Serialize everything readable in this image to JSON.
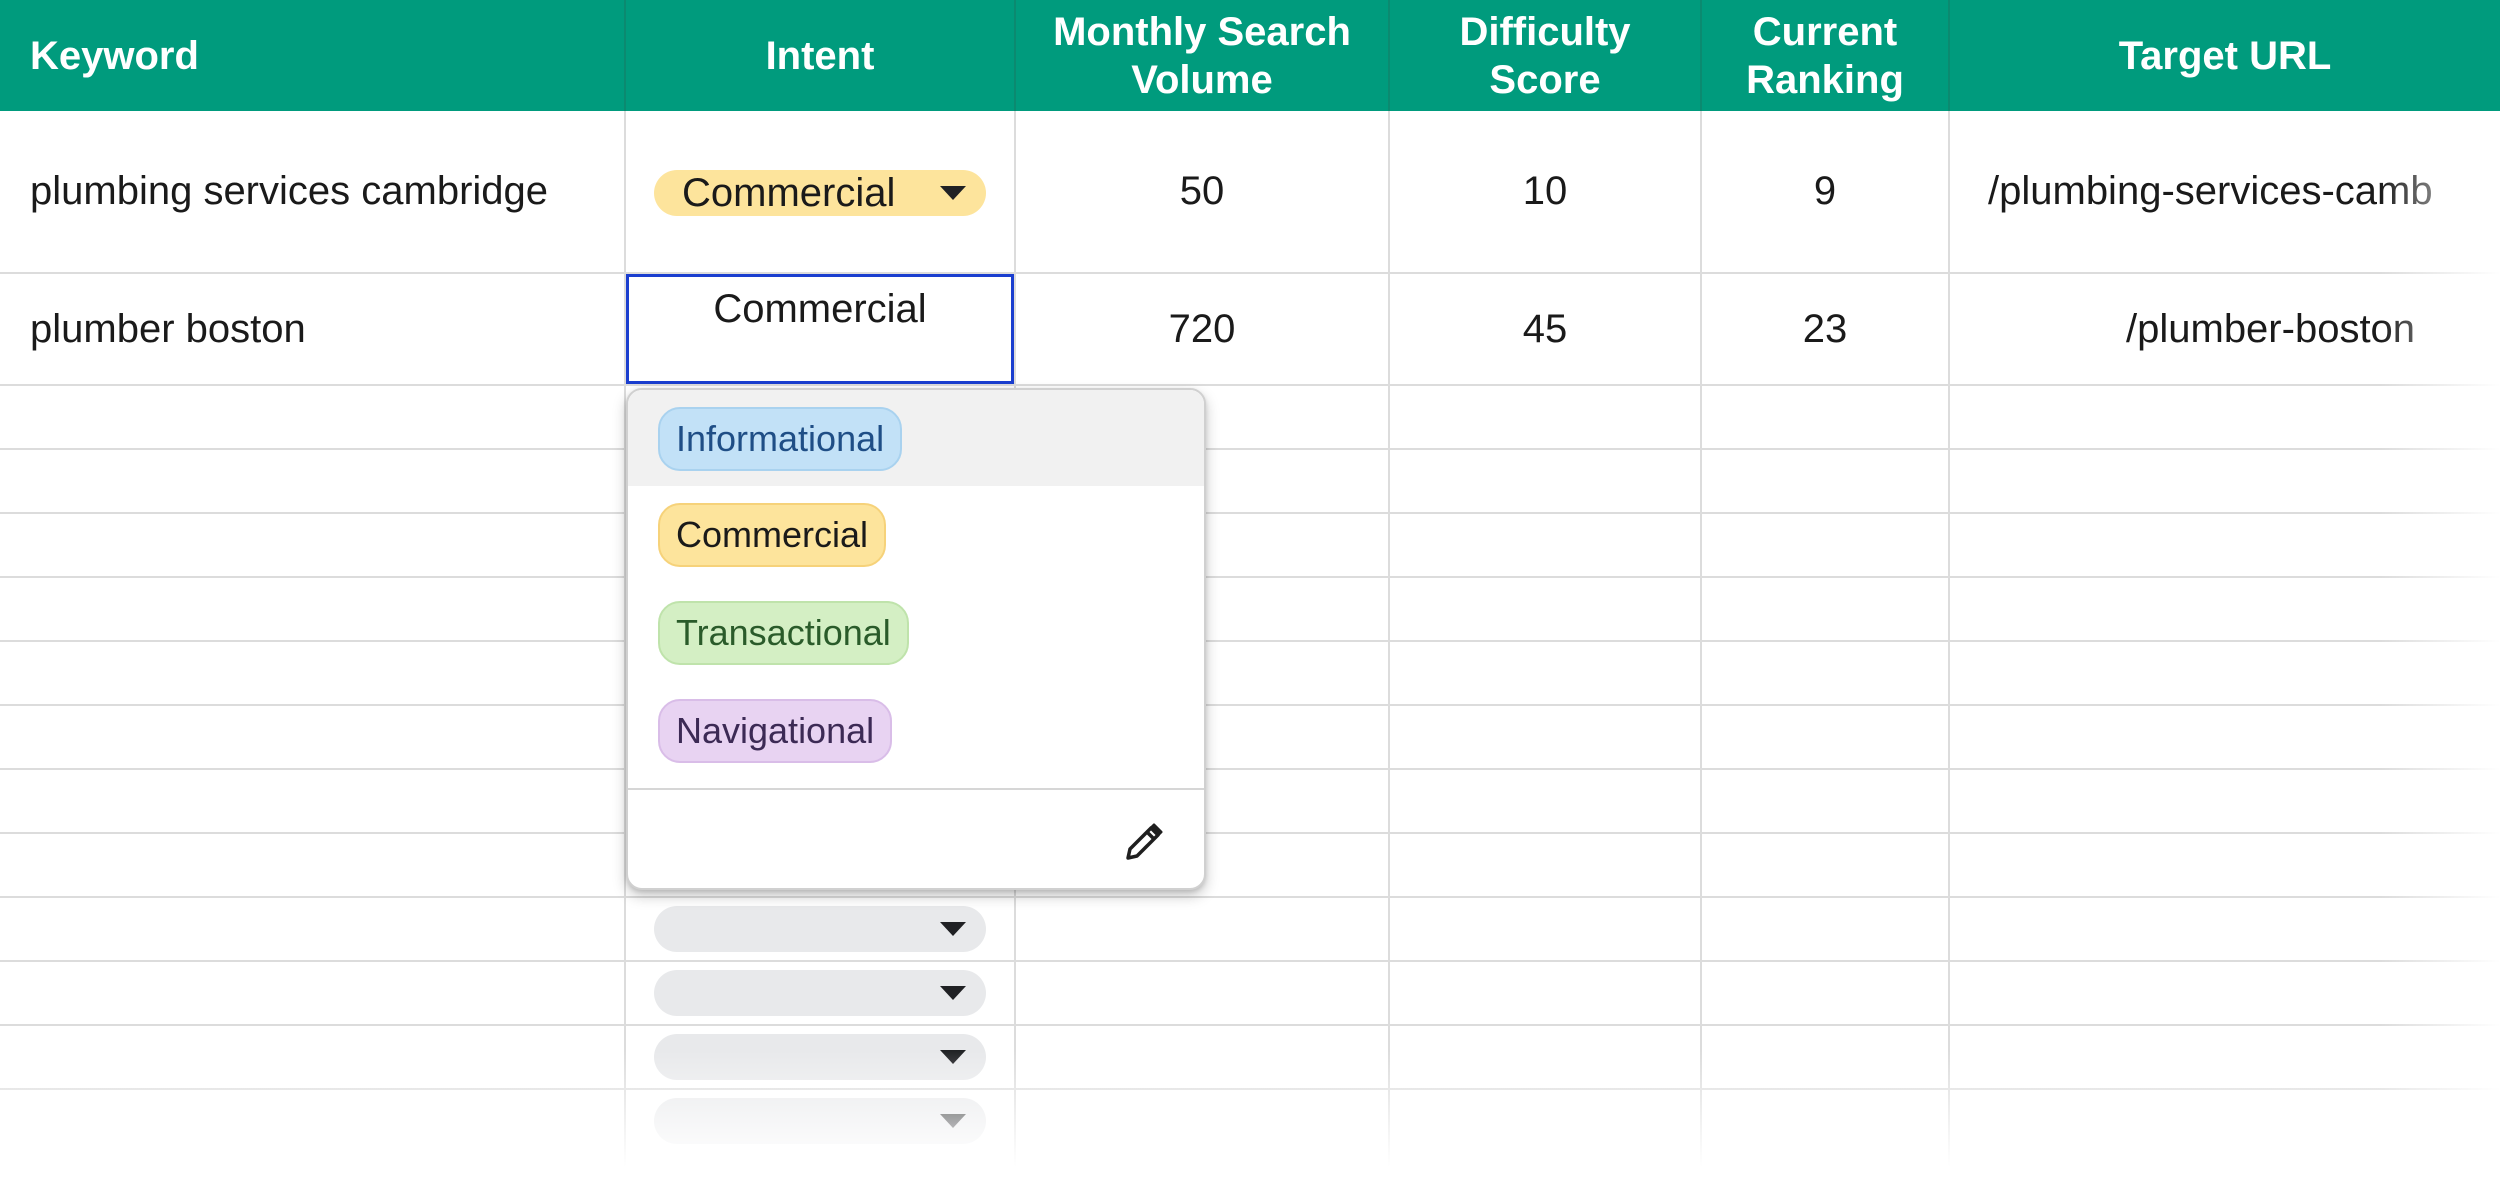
{
  "header": {
    "keyword": "Keyword",
    "intent": "Intent",
    "monthly_search_volume": "Monthly Search\nVolume",
    "difficulty_score": "Difficulty\nScore",
    "current_ranking": "Current\nRanking",
    "target_url": "Target URL"
  },
  "rows": [
    {
      "keyword": "plumbing services cambridge",
      "intent": "Commercial",
      "volume": "50",
      "difficulty": "10",
      "ranking": "9",
      "url": "/plumbing-services-camb"
    },
    {
      "keyword": "plumber boston",
      "intent": "Commercial",
      "volume": "720",
      "difficulty": "45",
      "ranking": "23",
      "url": "/plumber-boston"
    }
  ],
  "dropdown": {
    "options": [
      {
        "label": "Informational",
        "bg": "#c2e1f7",
        "border": "#a9d2ef",
        "color": "#1f4e86"
      },
      {
        "label": "Commercial",
        "bg": "#fde49c",
        "border": "#f6d27a",
        "color": "#1a1a1a"
      },
      {
        "label": "Transactional",
        "bg": "#d4efc4",
        "border": "#bfe3ab",
        "color": "#2a5b2a"
      },
      {
        "label": "Navigational",
        "bg": "#e8d3f2",
        "border": "#d9bde8",
        "color": "#3c2a55"
      }
    ],
    "edit_icon": "pencil-icon"
  },
  "colors": {
    "header_bg": "#009b7d",
    "edit_border": "#1a3ecf"
  }
}
